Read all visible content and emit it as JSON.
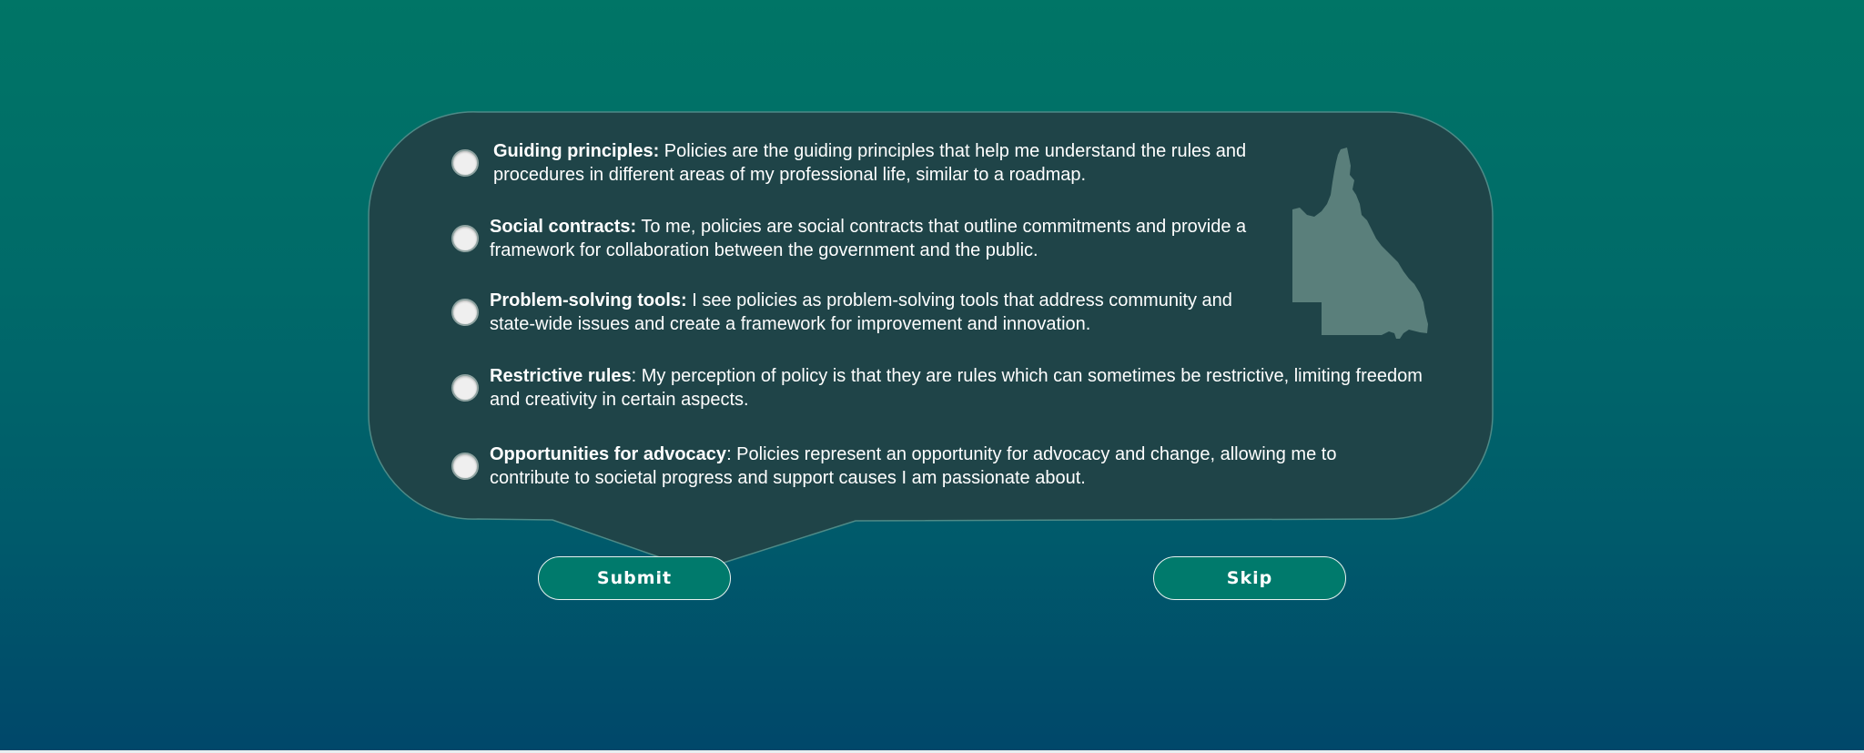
{
  "options": [
    {
      "title": "Guiding principles:",
      "text": " Policies are the guiding principles that help me understand the rules and procedures in different areas of my professional life, similar to a roadmap.",
      "selected": false
    },
    {
      "title": "Social contracts:",
      "text": " To me, policies are social contracts that outline commitments and provide a framework for collaboration between the government and the public.",
      "selected": false
    },
    {
      "title": "Problem-solving tools:",
      "text": " I see policies as problem-solving tools that address community and state-wide issues and create a framework for improvement and innovation.",
      "selected": false
    },
    {
      "title": "Restrictive rules",
      "text": ": My perception of policy is that they are rules which can sometimes be restrictive, limiting freedom and creativity in certain aspects.",
      "selected": false
    },
    {
      "title": "Opportunities for advocacy",
      "text": ": Policies represent an opportunity for advocacy and change, allowing me to contribute to societal progress and support causes I am passionate about.",
      "selected": false
    }
  ],
  "buttons": {
    "submit_label": "Submit",
    "skip_label": "Skip"
  },
  "decoration": {
    "map_icon": "queensland-map-icon"
  },
  "colors": {
    "bubble_fill": "#1f4448",
    "bubble_stroke": "#4e8a87",
    "button_fill": "#007a6c",
    "map_fill": "#5a7f7b"
  }
}
